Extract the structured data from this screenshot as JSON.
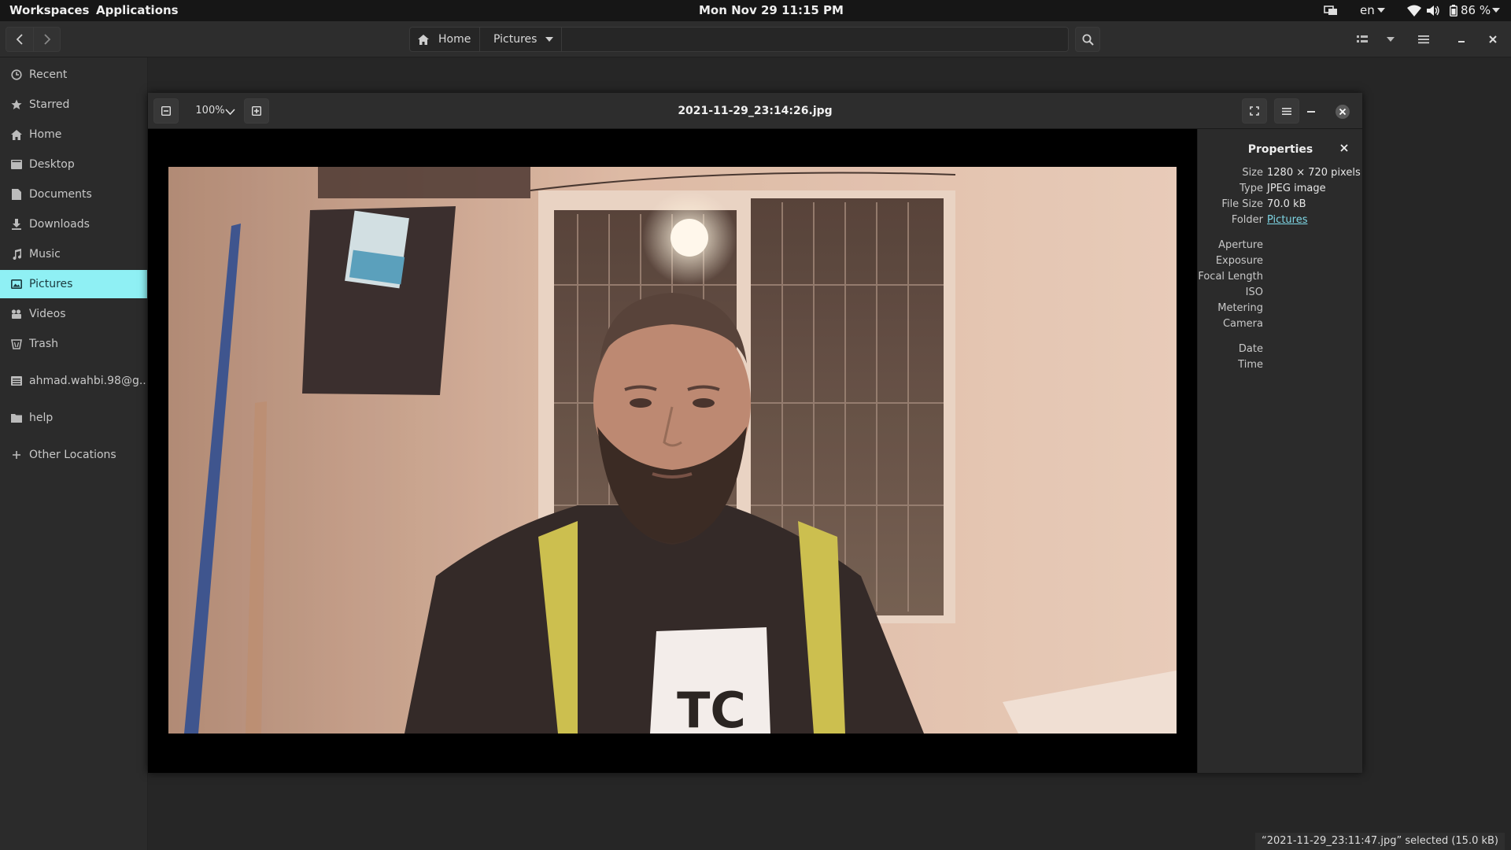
{
  "topbar": {
    "workspaces": "Workspaces",
    "applications": "Applications",
    "clock": "Mon Nov 29  11:15 PM",
    "language": "en",
    "battery": "86 %"
  },
  "header": {
    "path_home": "Home",
    "path_current": "Pictures"
  },
  "sidebar": {
    "items": [
      {
        "label": "Recent",
        "icon": "clock-icon"
      },
      {
        "label": "Starred",
        "icon": "star-icon"
      },
      {
        "label": "Home",
        "icon": "home-icon"
      },
      {
        "label": "Desktop",
        "icon": "desktop-icon"
      },
      {
        "label": "Documents",
        "icon": "document-icon"
      },
      {
        "label": "Downloads",
        "icon": "download-icon"
      },
      {
        "label": "Music",
        "icon": "music-icon"
      },
      {
        "label": "Pictures",
        "icon": "picture-icon",
        "active": true
      },
      {
        "label": "Videos",
        "icon": "video-icon"
      },
      {
        "label": "Trash",
        "icon": "trash-icon"
      },
      {
        "label": "ahmad.wahbi.98@g...",
        "icon": "drive-icon"
      },
      {
        "label": "help",
        "icon": "folder-icon"
      },
      {
        "label": "Other Locations",
        "icon": "plus-icon"
      }
    ]
  },
  "viewer": {
    "zoom": "100%",
    "title": "2021-11-29_23:14:26.jpg"
  },
  "properties": {
    "title": "Properties",
    "size_label": "Size",
    "size_value": "1280 × 720 pixels",
    "type_label": "Type",
    "type_value": "JPEG image",
    "filesize_label": "File Size",
    "filesize_value": "70.0 kB",
    "folder_label": "Folder",
    "folder_value": "Pictures",
    "aperture_label": "Aperture",
    "exposure_label": "Exposure",
    "focal_label": "Focal Length",
    "iso_label": "ISO",
    "metering_label": "Metering",
    "camera_label": "Camera",
    "date_label": "Date",
    "time_label": "Time"
  },
  "status": "“2021-11-29_23:11:47.jpg” selected  (15.0 kB)",
  "colors": {
    "accent": "#8ff0f4",
    "link": "#7fd7e6",
    "panel": "#161616",
    "header": "#2d2d2d"
  }
}
